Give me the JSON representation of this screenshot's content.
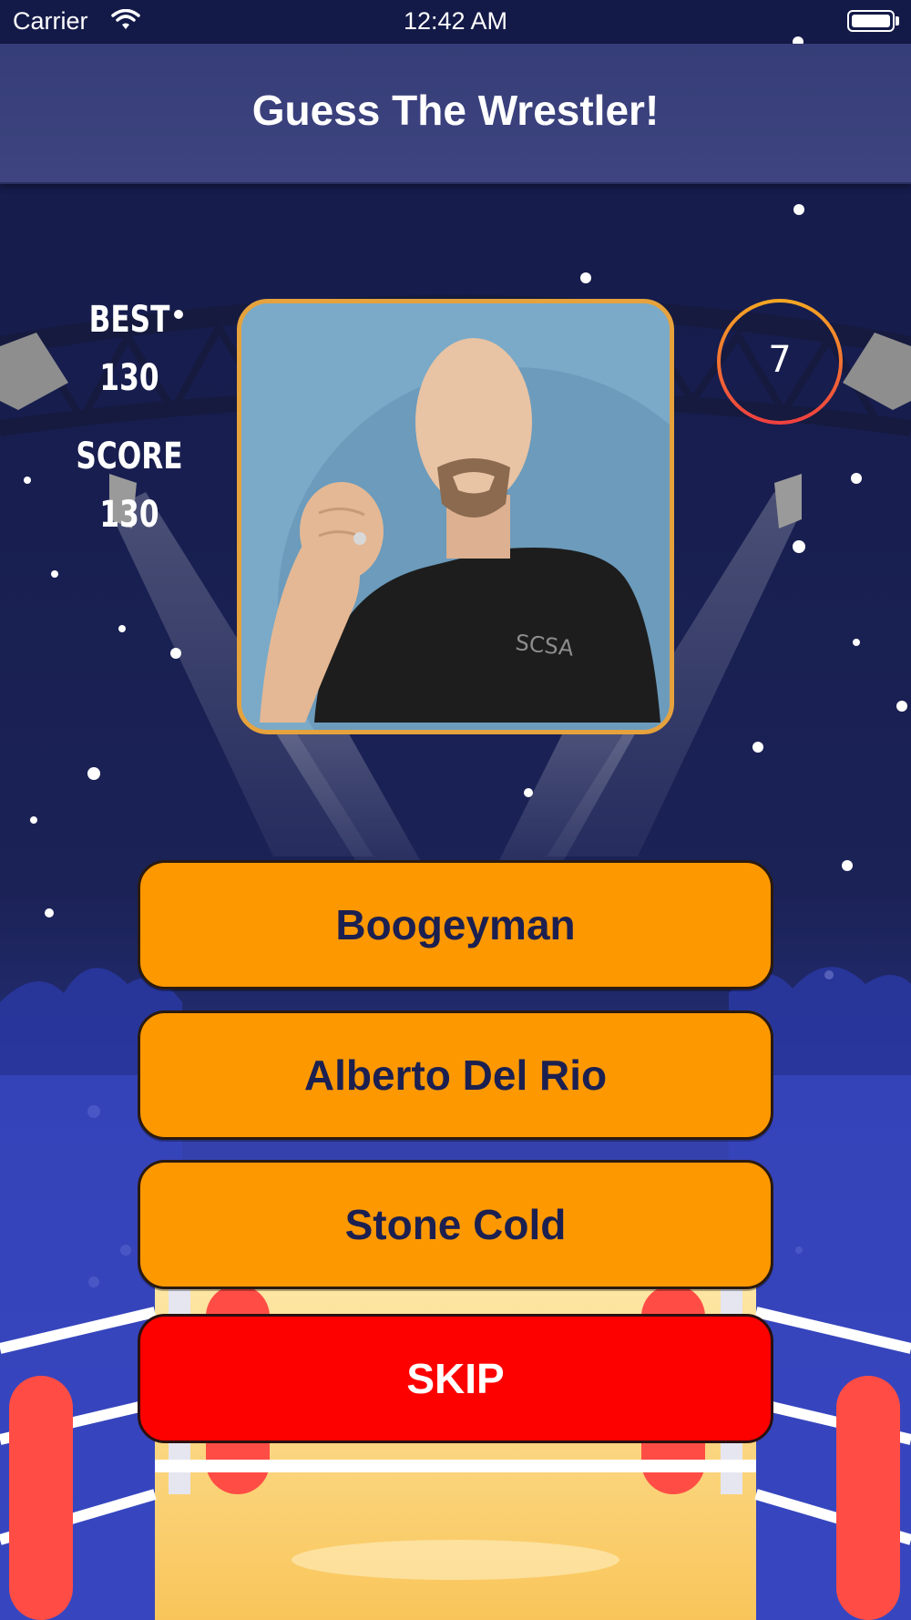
{
  "status_bar": {
    "carrier": "Carrier",
    "time": "12:42 AM"
  },
  "header": {
    "title": "Guess The Wrestler!"
  },
  "stats": {
    "best_label": "BEST",
    "best_value": "130",
    "score_label": "SCORE",
    "score_value": "130"
  },
  "timer": {
    "value": "7",
    "progress": 1.0
  },
  "question": {
    "image_description_icon": "wrestler-portrait-image"
  },
  "answers": [
    {
      "label": "Boogeyman"
    },
    {
      "label": "Alberto Del Rio"
    },
    {
      "label": "Stone Cold"
    }
  ],
  "skip": {
    "label": "SKIP"
  },
  "colors": {
    "background": "#1a1f4f",
    "nav_bar": "#3a417c",
    "answer_button": "#fd9800",
    "answer_text": "#1c2050",
    "skip_button": "#fd0000",
    "frame_border": "#e6a23c",
    "timer_ring": "#f5822f"
  }
}
